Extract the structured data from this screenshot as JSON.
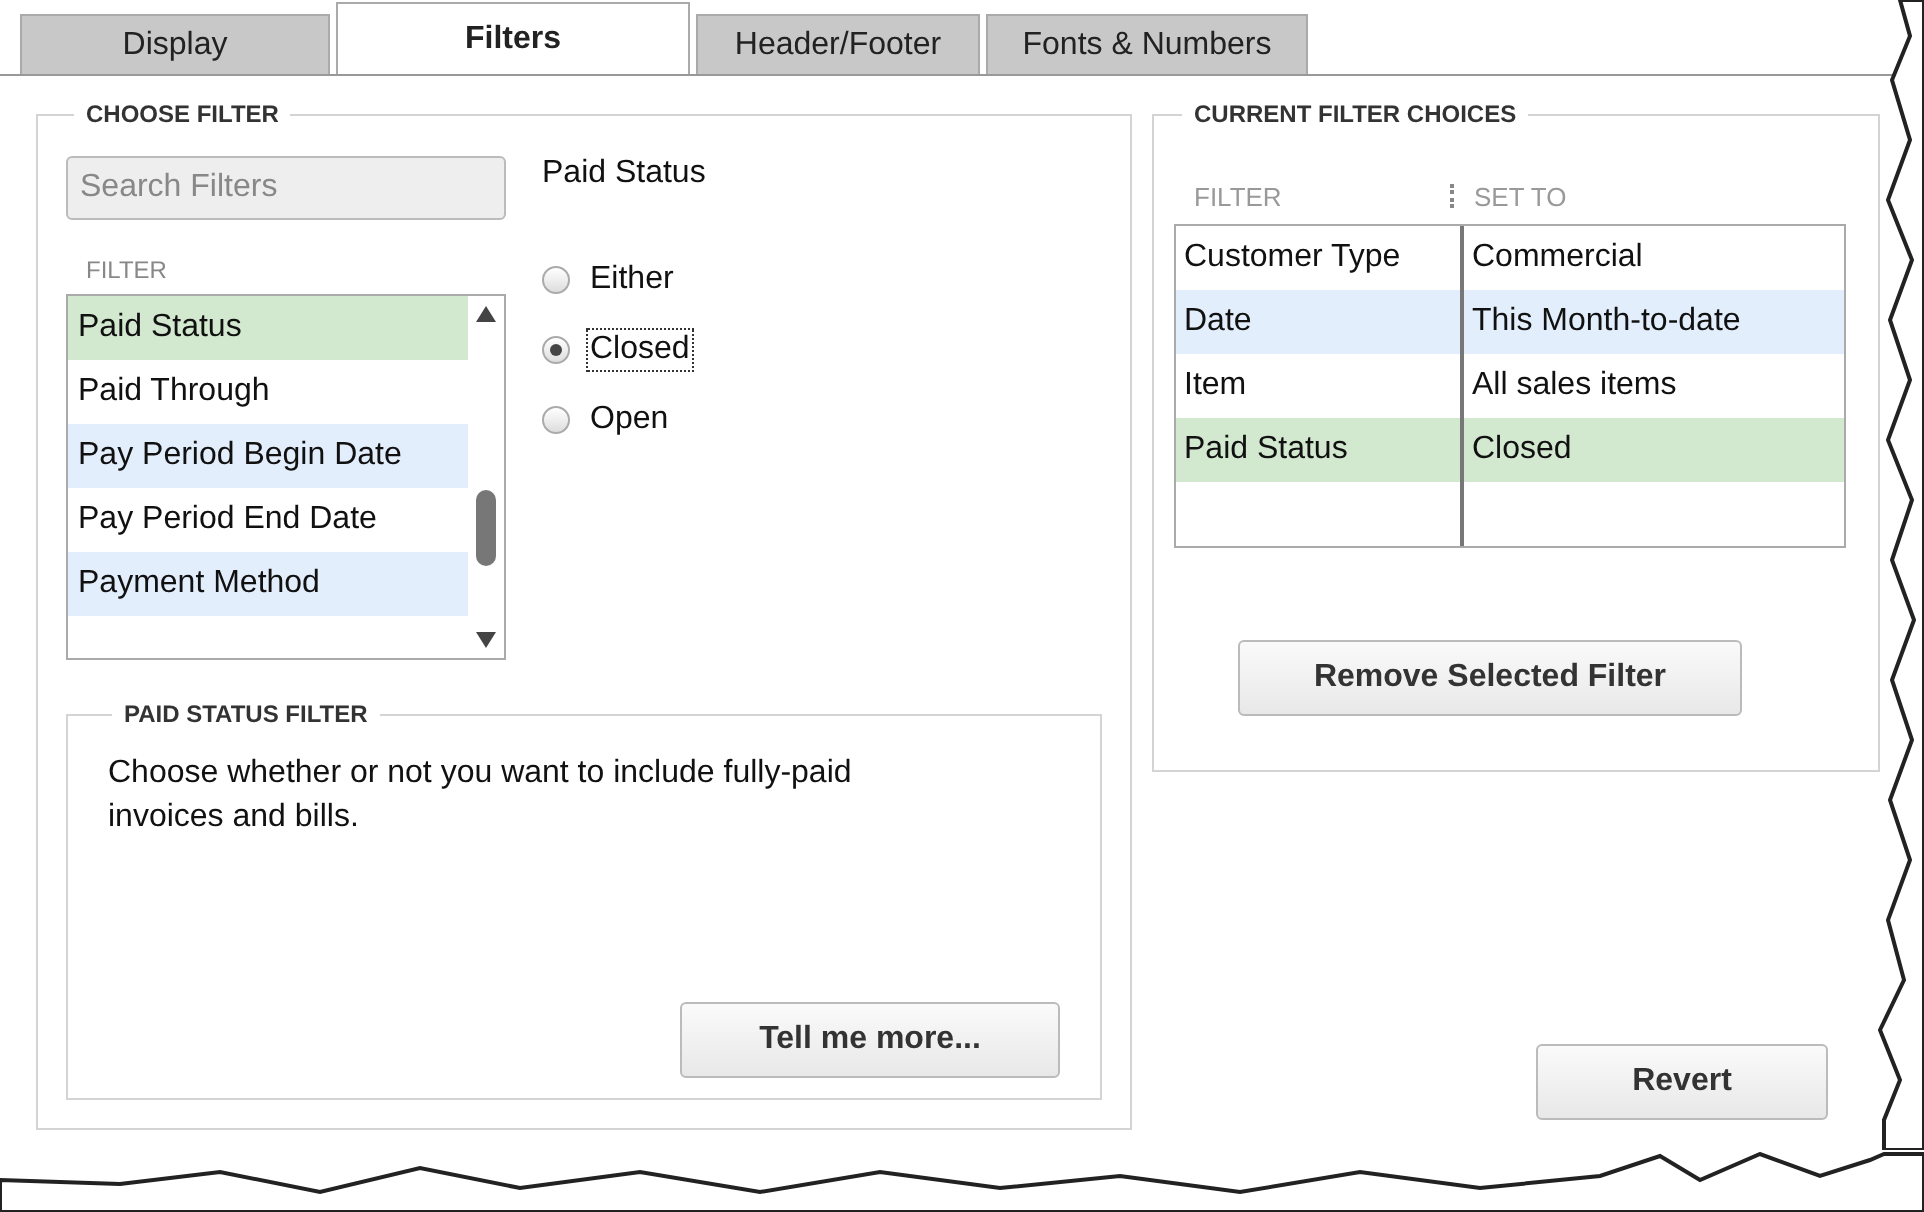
{
  "tabs": [
    {
      "label": "Display",
      "selected": false
    },
    {
      "label": "Filters",
      "selected": true
    },
    {
      "label": "Header/Footer",
      "selected": false
    },
    {
      "label": "Fonts & Numbers",
      "selected": false
    }
  ],
  "choose_filter": {
    "title": "CHOOSE FILTER",
    "search": {
      "placeholder": "Search Filters"
    },
    "list_header": "FILTER",
    "items": [
      {
        "label": "Paid Status",
        "selected": true
      },
      {
        "label": "Paid Through",
        "selected": false
      },
      {
        "label": "Pay Period Begin Date",
        "selected": false
      },
      {
        "label": "Pay Period End Date",
        "selected": false
      },
      {
        "label": "Payment Method",
        "selected": false
      }
    ],
    "option_title": "Paid Status",
    "options": [
      {
        "label": "Either",
        "selected": false
      },
      {
        "label": "Closed",
        "selected": true
      },
      {
        "label": "Open",
        "selected": false
      }
    ]
  },
  "help": {
    "title": "PAID STATUS FILTER",
    "text": "Choose whether or not you want to include fully-paid invoices and bills.",
    "button": {
      "label": "Tell me more..."
    }
  },
  "current": {
    "title": "CURRENT FILTER CHOICES",
    "columns": [
      "FILTER",
      "SET TO"
    ],
    "rows": [
      {
        "filter": "Customer Type",
        "set_to": "Commercial",
        "selected": false
      },
      {
        "filter": "Date",
        "set_to": "This Month-to-date",
        "selected": false
      },
      {
        "filter": "Item",
        "set_to": "All sales items",
        "selected": false
      },
      {
        "filter": "Paid Status",
        "set_to": "Closed",
        "selected": true
      }
    ],
    "button": {
      "label": "Remove Selected Filter"
    }
  },
  "revert": {
    "label": "Revert"
  }
}
